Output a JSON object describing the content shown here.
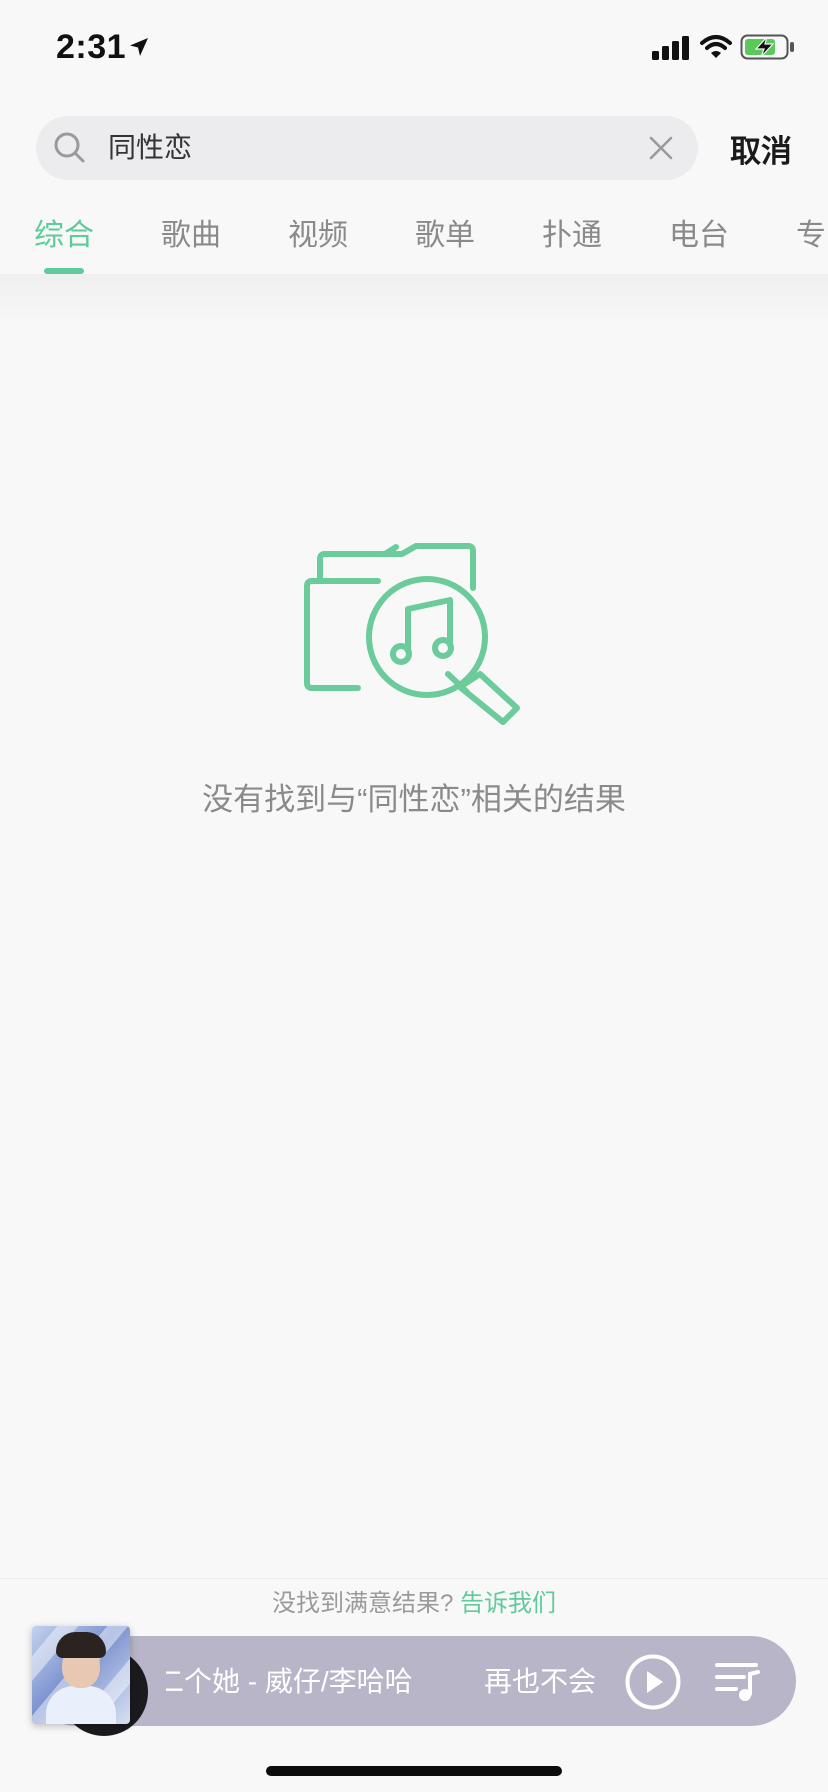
{
  "status_bar": {
    "time": "2:31"
  },
  "search": {
    "query": "同性恋",
    "cancel_label": "取消"
  },
  "tabs": [
    {
      "label": "综合",
      "active": true
    },
    {
      "label": "歌曲",
      "active": false
    },
    {
      "label": "视频",
      "active": false
    },
    {
      "label": "歌单",
      "active": false
    },
    {
      "label": "扑通",
      "active": false
    },
    {
      "label": "电台",
      "active": false
    },
    {
      "label": "专",
      "active": false
    }
  ],
  "empty_state": {
    "icon": "folder-music-search-icon",
    "message": "没有找到与“同性恋”相关的结果"
  },
  "feedback": {
    "prompt": "没找到满意结果?",
    "link": "告诉我们"
  },
  "player": {
    "now_playing": "二个她 - 威仔/李哈哈",
    "next_song": "再也不会"
  },
  "colors": {
    "accent": "#5fca9a",
    "player_bg": "#b8b5c8"
  }
}
